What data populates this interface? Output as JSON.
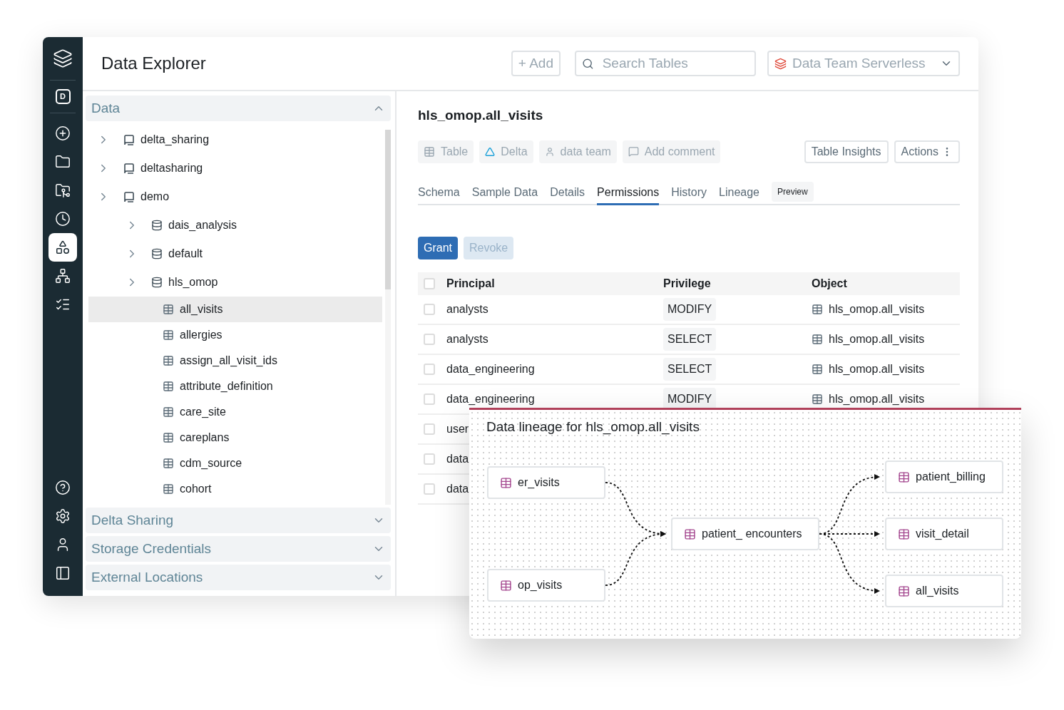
{
  "sidebar": {
    "workspace_badge": "D",
    "items": [
      {
        "selected": false
      },
      {
        "selected": false
      },
      {
        "selected": false
      },
      {
        "selected": false
      },
      {
        "selected": true
      },
      {
        "selected": false
      },
      {
        "selected": false
      }
    ],
    "bottom_items": [
      {
        "selected": false
      },
      {
        "selected": false
      },
      {
        "selected": false
      },
      {
        "selected": false
      }
    ]
  },
  "header": {
    "title": "Data Explorer",
    "add_button": "+ Add",
    "search": {
      "placeholder": "Search Tables"
    },
    "warehouse": "Data Team Serverless"
  },
  "sections": [
    {
      "title": "Data",
      "expanded": true
    },
    {
      "title": "Delta Sharing",
      "expanded": false
    },
    {
      "title": "Storage Credentials",
      "expanded": false
    },
    {
      "title": "External Locations",
      "expanded": false
    }
  ],
  "tree": [
    {
      "label": "delta_sharing",
      "kind": "catalog",
      "selected": false
    },
    {
      "label": "deltasharing",
      "kind": "catalog",
      "selected": false
    },
    {
      "label": "demo",
      "kind": "catalog",
      "selected": false,
      "children": [
        {
          "label": "dais_analysis",
          "kind": "schema",
          "selected": false
        },
        {
          "label": "default",
          "kind": "schema",
          "selected": false
        },
        {
          "label": "hls_omop",
          "kind": "schema",
          "selected": false
        },
        {
          "label": "all_visits",
          "kind": "table",
          "selected": true
        },
        {
          "label": "allergies",
          "kind": "table",
          "selected": false
        },
        {
          "label": "assign_all_visit_ids",
          "kind": "table",
          "selected": false
        },
        {
          "label": "attribute_definition",
          "kind": "table",
          "selected": false
        },
        {
          "label": "care_site",
          "kind": "table",
          "selected": false
        },
        {
          "label": "careplans",
          "kind": "table",
          "selected": false
        },
        {
          "label": "cdm_source",
          "kind": "table",
          "selected": false
        },
        {
          "label": "cohort",
          "kind": "table",
          "selected": false
        }
      ]
    }
  ],
  "detail": {
    "title": "hls_omop.all_visits",
    "tags": [
      {
        "label": "Table",
        "kind": "table"
      },
      {
        "label": "Delta",
        "kind": "delta"
      },
      {
        "label": "data team",
        "kind": "owner"
      },
      {
        "label": "Add comment",
        "kind": "comment"
      }
    ],
    "buttons": [
      {
        "label": "Table Insights",
        "kind": "plain"
      },
      {
        "label": "Actions",
        "kind": "menu"
      }
    ],
    "tabs": [
      {
        "label": "Schema",
        "selected": false
      },
      {
        "label": "Sample Data",
        "selected": false
      },
      {
        "label": "Details",
        "selected": false
      },
      {
        "label": "Permissions",
        "selected": true
      },
      {
        "label": "History",
        "selected": false
      },
      {
        "label": "Lineage",
        "selected": false
      }
    ],
    "preview_badge": "Preview",
    "actions": [
      {
        "label": "Grant",
        "disabled": false
      },
      {
        "label": "Revoke",
        "disabled": true
      }
    ],
    "table": {
      "columns": [
        "Principal",
        "Privilege",
        "Object"
      ],
      "header_checked": false,
      "rows": [
        {
          "checked": false,
          "principal": "analysts",
          "privilege": "MODIFY",
          "object": "hls_omop.all_visits"
        },
        {
          "checked": false,
          "principal": "analysts",
          "privilege": "SELECT",
          "object": "hls_omop.all_visits"
        },
        {
          "checked": false,
          "principal": "data_engineering",
          "privilege": "SELECT",
          "object": "hls_omop.all_visits"
        },
        {
          "checked": false,
          "principal": "data_engineering",
          "privilege": "MODIFY",
          "object": "hls_omop.all_visits"
        },
        {
          "checked": false,
          "principal": "user"
        },
        {
          "checked": false,
          "principal": "data"
        },
        {
          "checked": false,
          "principal": "data"
        }
      ]
    }
  },
  "lineage": {
    "title": "Data lineage for hls_omop.all_visits",
    "nodes": [
      {
        "label": "er_visits",
        "kind": "upstream"
      },
      {
        "label": "op_visits",
        "kind": "upstream"
      },
      {
        "label": "patient_ encounters",
        "kind": "focus"
      },
      {
        "label": "patient_billing",
        "kind": "downstream"
      },
      {
        "label": "visit_detail",
        "kind": "downstream"
      },
      {
        "label": "all_visits",
        "kind": "downstream"
      }
    ]
  }
}
